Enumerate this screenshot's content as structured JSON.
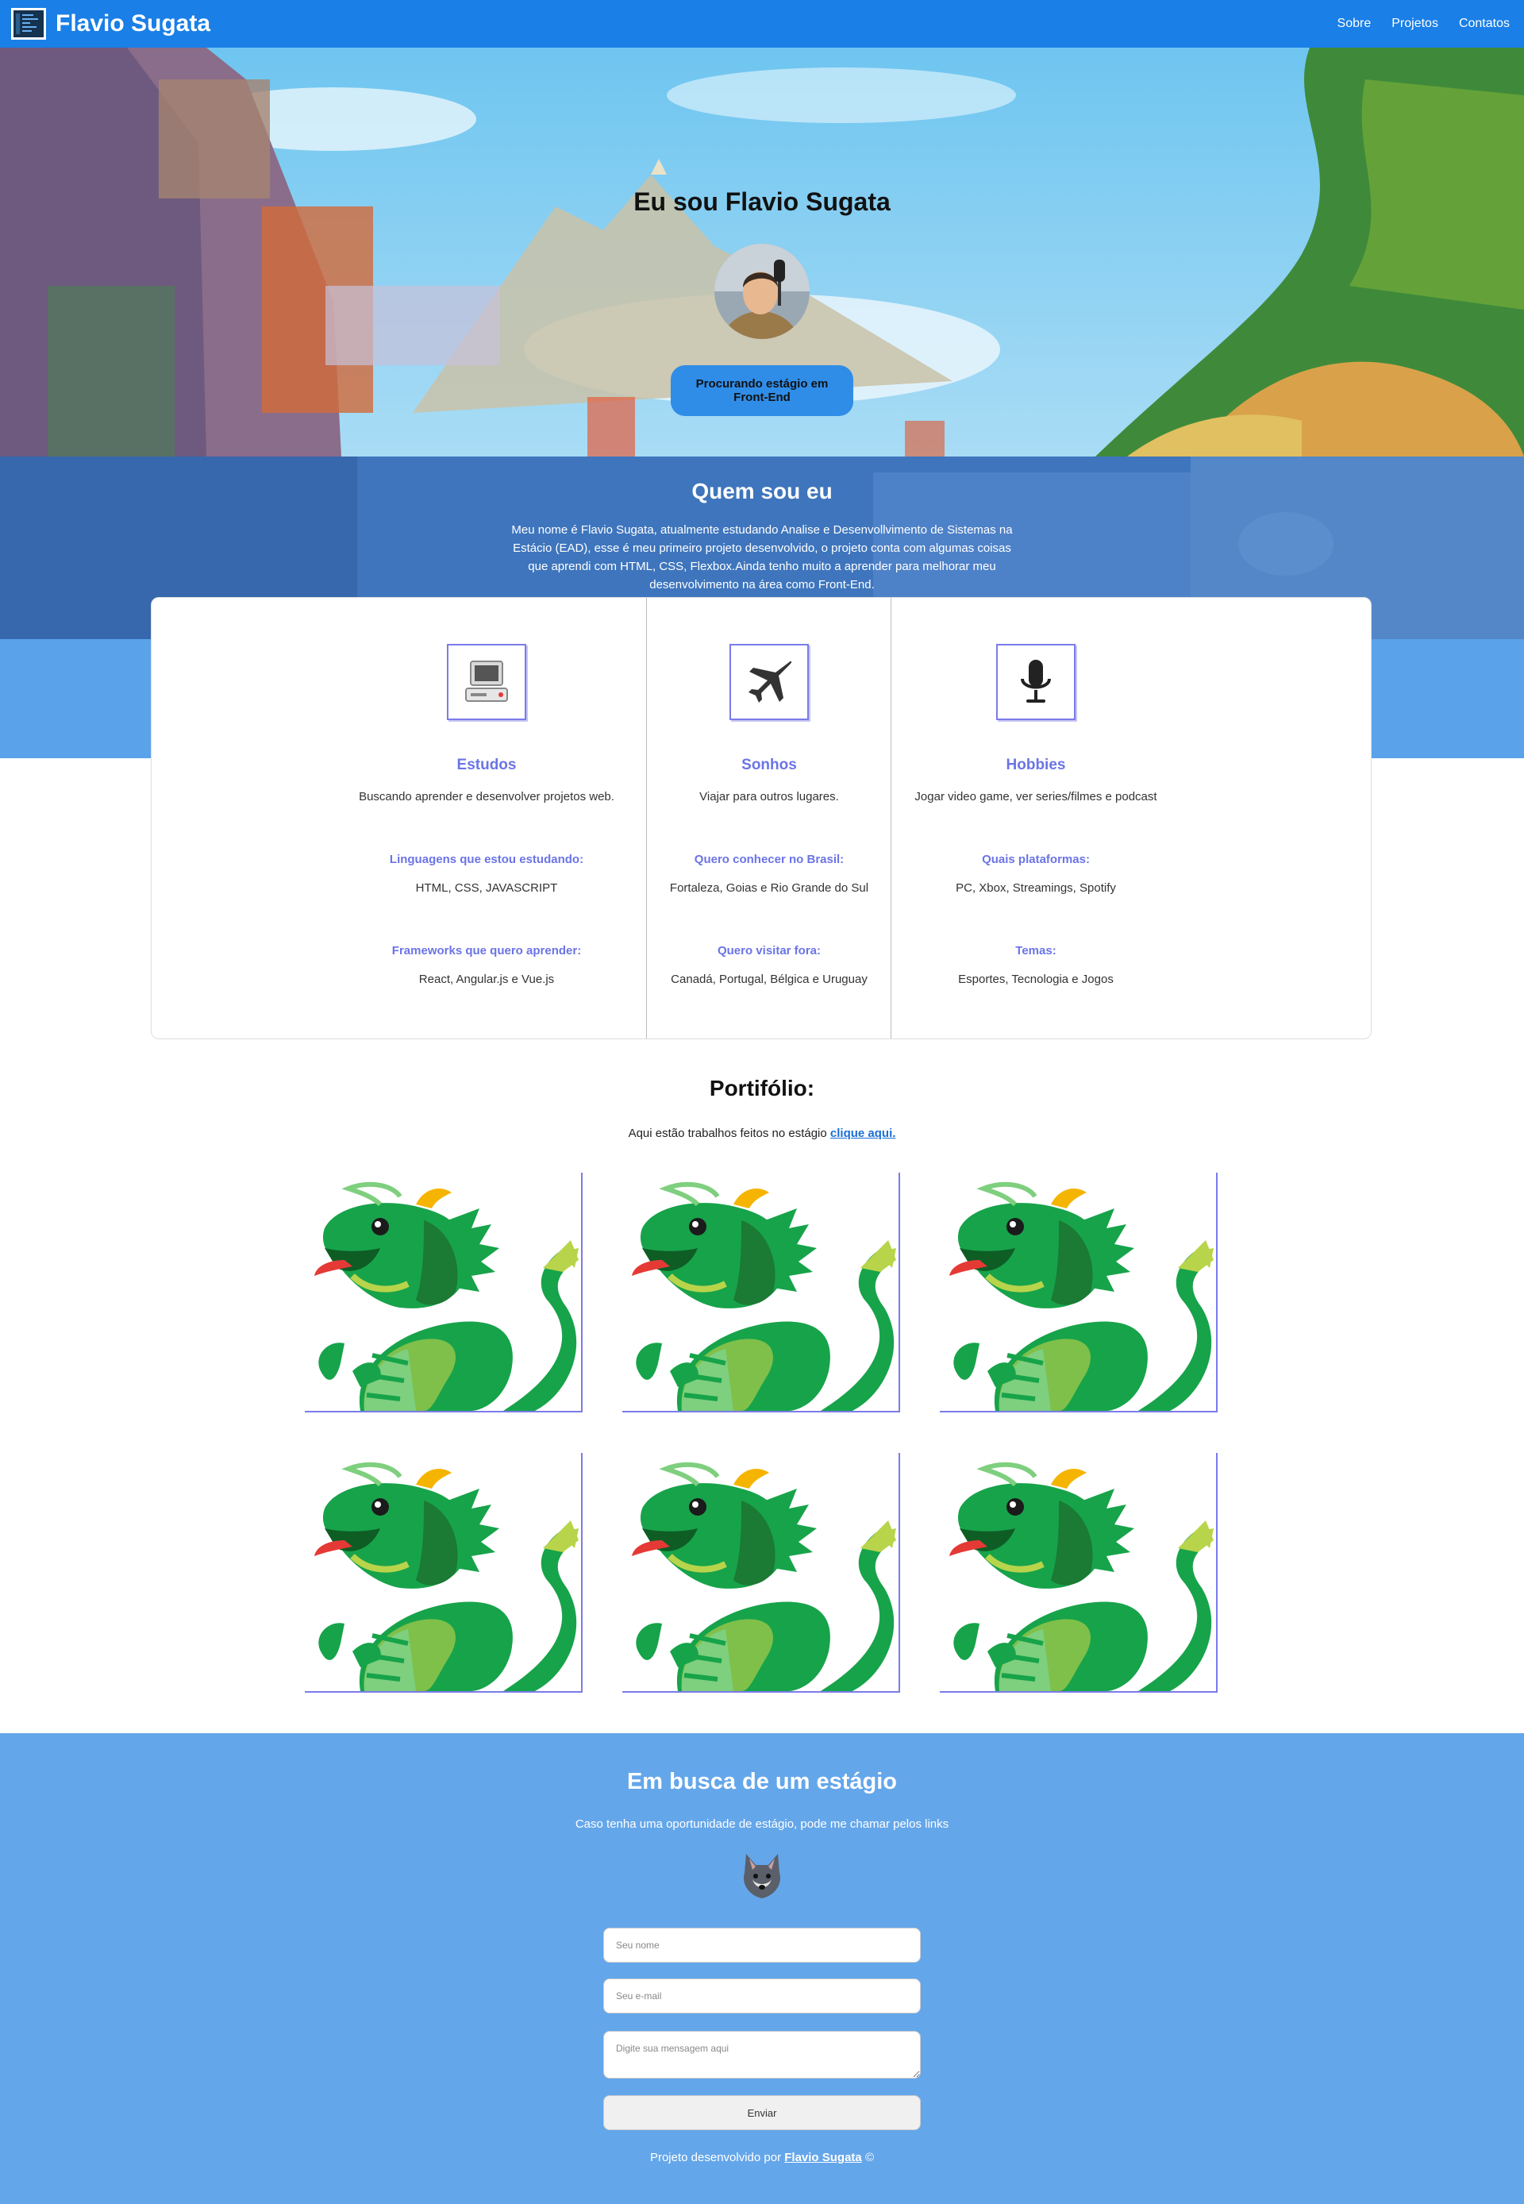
{
  "nav": {
    "brand": "Flavio Sugata",
    "links": [
      "Sobre",
      "Projetos",
      "Contatos"
    ]
  },
  "hero": {
    "title": "Eu sou Flavio Sugata",
    "cta": "Procurando estágio em Front-End"
  },
  "about": {
    "title": "Quem sou eu",
    "text": "Meu nome é Flavio Sugata, atualmente estudando Analise e Desenvollvimento de Sistemas na Estácio (EAD), esse é meu primeiro projeto desenvolvido, o projeto conta com algumas coisas que aprendi com HTML, CSS, Flexbox.Ainda tenho muito a aprender para melhorar meu desenvolvimento na área como Front-End."
  },
  "cards": [
    {
      "icon": "computer-icon",
      "title": "Estudos",
      "desc": "Buscando aprender e desenvolver projetos web.",
      "items": [
        {
          "label": "Linguagens que estou estudando:",
          "value": "HTML, CSS, JAVASCRIPT"
        },
        {
          "label": "Frameworks que quero aprender:",
          "value": "React, Angular.js e Vue.js"
        }
      ]
    },
    {
      "icon": "airplane-icon",
      "title": "Sonhos",
      "desc": "Viajar para outros lugares.",
      "items": [
        {
          "label": "Quero conhecer no Brasil:",
          "value": "Fortaleza, Goias e Rio Grande do Sul"
        },
        {
          "label": "Quero visitar fora:",
          "value": "Canadá, Portugal, Bélgica e Uruguay"
        }
      ]
    },
    {
      "icon": "microphone-icon",
      "title": "Hobbies",
      "desc": "Jogar video game, ver series/filmes e podcast",
      "items": [
        {
          "label": "Quais plataformas:",
          "value": "PC, Xbox, Streamings, Spotify"
        },
        {
          "label": "Temas:",
          "value": "Esportes, Tecnologia e Jogos"
        }
      ]
    }
  ],
  "portfolio": {
    "title": "Portifólio:",
    "text": "Aqui estão trabalhos feitos no estágio",
    "link": "clique aqui.",
    "thumb_icon": "dragon-icon"
  },
  "contact": {
    "title": "Em busca de um estágio",
    "text": "Caso tenha uma oportunidade de estágio, pode me chamar pelos links",
    "name_placeholder": "Seu nome",
    "email_placeholder": "Seu e-mail",
    "message_placeholder": "Digite sua mensagem aqui",
    "send_label": "Enviar",
    "credit_prefix": "Projeto desenvolvido por",
    "credit_name": "Flavio Sugata",
    "credit_suffix": "©"
  },
  "colors": {
    "nav": "#1a7fe6",
    "accent": "#6b74e6",
    "footer": "#64a6ea"
  }
}
